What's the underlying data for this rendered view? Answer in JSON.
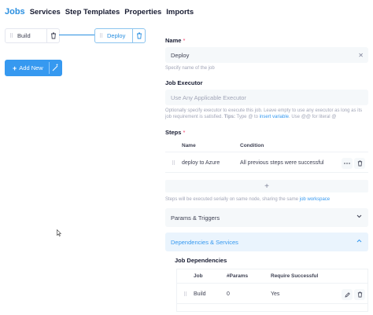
{
  "nav": {
    "tabs": [
      "Jobs",
      "Services",
      "Step Templates",
      "Properties",
      "Imports"
    ],
    "active": "Jobs"
  },
  "canvas": {
    "jobs": [
      {
        "name": "Build",
        "selected": false
      },
      {
        "name": "Deploy",
        "selected": true
      }
    ],
    "add_button": "Add New"
  },
  "form": {
    "name": {
      "label": "Name",
      "value": "Deploy",
      "help": "Specify name of the job"
    },
    "executor": {
      "label": "Job Executor",
      "placeholder": "Use Any Applicable Executor",
      "help_prefix": "Optionally specify executor to execute this job. Leave empty to use any executor as long as its job requirement is satisfied.",
      "help_tips": "Tips:",
      "help_mid": "Type",
      "help_at": "@",
      "help_to": "to",
      "help_insert": "insert variable",
      "help_use": ". Use",
      "help_atat": "@@",
      "help_literal": "for literal",
      "help_literal_at": "@"
    },
    "steps": {
      "label": "Steps",
      "columns": [
        "Name",
        "Condition"
      ],
      "rows": [
        {
          "name": "deploy to Azure",
          "condition": "All previous steps were successful"
        }
      ],
      "add_symbol": "+",
      "help_prefix": "Steps will be executed serially on same node, sharing the same",
      "help_link": "job workspace"
    },
    "params_section": "Params & Triggers",
    "deps_section": "Dependencies & Services",
    "job_dependencies": {
      "label": "Job Dependencies",
      "columns": [
        "Job",
        "#Params",
        "Require Successful"
      ],
      "rows": [
        {
          "job": "Build",
          "params": "0",
          "require_successful": "Yes"
        }
      ]
    }
  },
  "colors": {
    "accent": "#3699f0",
    "required": "#f1416c"
  }
}
